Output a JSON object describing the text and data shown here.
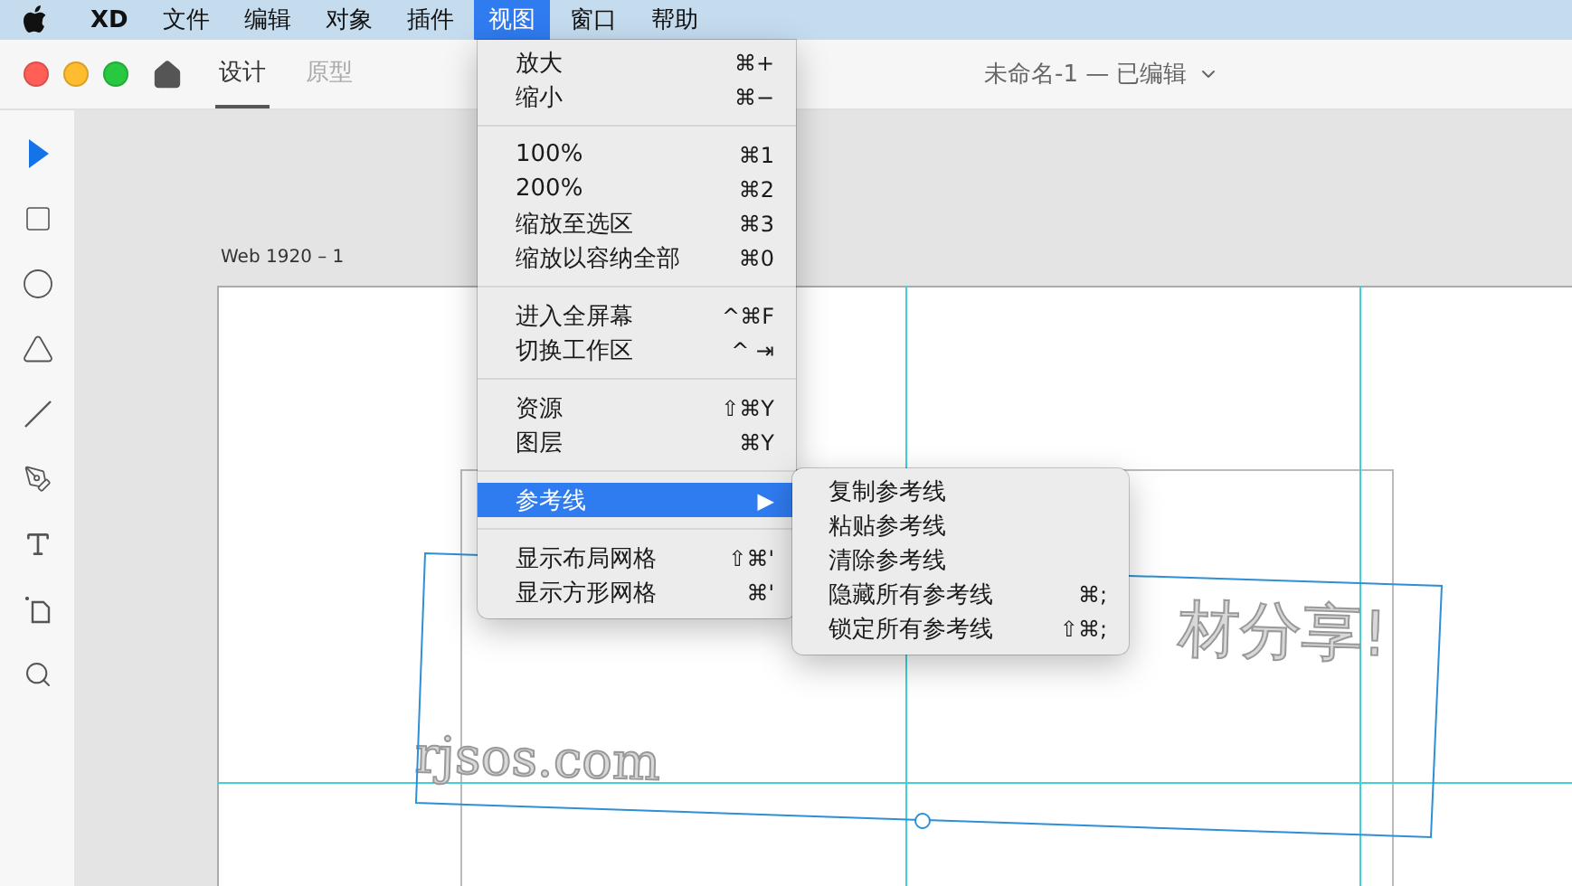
{
  "menu_bar": {
    "items": [
      {
        "label": "XD",
        "selected": false,
        "bold": true
      },
      {
        "label": "文件",
        "selected": false
      },
      {
        "label": "编辑",
        "selected": false
      },
      {
        "label": "对象",
        "selected": false
      },
      {
        "label": "插件",
        "selected": false
      },
      {
        "label": "视图",
        "selected": true
      },
      {
        "label": "窗口",
        "selected": false
      },
      {
        "label": "帮助",
        "selected": false
      }
    ]
  },
  "window": {
    "tabs": [
      {
        "label": "设计",
        "selected": true
      },
      {
        "label": "原型",
        "selected": false
      }
    ],
    "document_title": "未命名-1 — 已编辑"
  },
  "tools": [
    {
      "kind": "select",
      "selected": true
    },
    {
      "kind": "rectangle",
      "selected": false
    },
    {
      "kind": "ellipse",
      "selected": false
    },
    {
      "kind": "polygon",
      "selected": false
    },
    {
      "kind": "line",
      "selected": false
    },
    {
      "kind": "pen",
      "selected": false
    },
    {
      "kind": "text",
      "selected": false
    },
    {
      "kind": "artboard",
      "selected": false
    },
    {
      "kind": "zoom",
      "selected": false
    }
  ],
  "artboard": {
    "label": "Web 1920 – 1",
    "texts": [
      {
        "kind": "heading_end",
        "text": "材分享!"
      },
      {
        "kind": "url",
        "text": "rjsos.com"
      }
    ]
  },
  "view_menu": {
    "sections": [
      [
        {
          "label": "放大",
          "shortcut": "⌘+",
          "selected": false
        },
        {
          "label": "缩小",
          "shortcut": "⌘−",
          "selected": false
        }
      ],
      [
        {
          "label": "100%",
          "shortcut": "⌘1",
          "selected": false
        },
        {
          "label": "200%",
          "shortcut": "⌘2",
          "selected": false
        },
        {
          "label": "缩放至选区",
          "shortcut": "⌘3",
          "selected": false
        },
        {
          "label": "缩放以容纳全部",
          "shortcut": "⌘0",
          "selected": false
        }
      ],
      [
        {
          "label": "进入全屏幕",
          "shortcut": "^⌘F",
          "selected": false
        },
        {
          "label": "切换工作区",
          "shortcut": "^ ⇥",
          "selected": false
        }
      ],
      [
        {
          "label": "资源",
          "shortcut": "⇧⌘Y",
          "selected": false
        },
        {
          "label": "图层",
          "shortcut": "⌘Y",
          "selected": false
        }
      ],
      [
        {
          "label": "参考线",
          "shortcut": "▶",
          "selected": true
        }
      ],
      [
        {
          "label": "显示布局网格",
          "shortcut": "⇧⌘'",
          "selected": false
        },
        {
          "label": "显示方形网格",
          "shortcut": "⌘'",
          "selected": false
        }
      ]
    ]
  },
  "guides_submenu": {
    "items": [
      {
        "label": "复制参考线"
      },
      {
        "label": "粘贴参考线"
      },
      {
        "label": "清除参考线"
      },
      {
        "label": "隐藏所有参考线",
        "shortcut": "⌘;"
      },
      {
        "label": "锁定所有参考线",
        "shortcut": "⇧⌘;"
      }
    ]
  }
}
